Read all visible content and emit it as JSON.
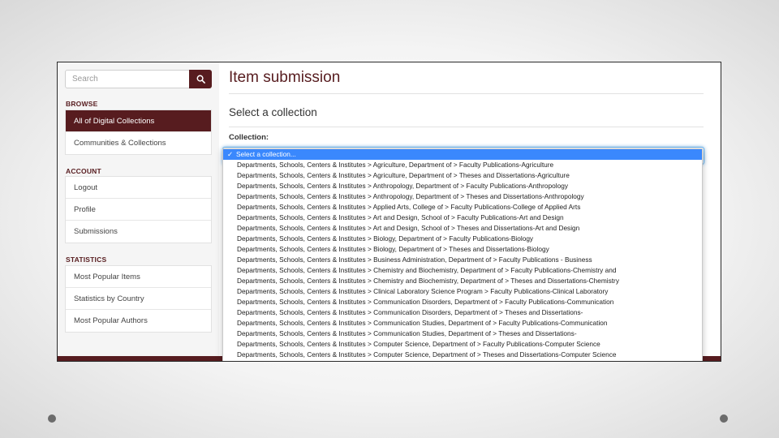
{
  "search": {
    "placeholder": "Search"
  },
  "sidebar": {
    "browse": {
      "heading": "BROWSE",
      "items": [
        {
          "label": "All of Digital Collections",
          "active": true
        },
        {
          "label": "Communities & Collections"
        }
      ]
    },
    "account": {
      "heading": "ACCOUNT",
      "items": [
        {
          "label": "Logout"
        },
        {
          "label": "Profile"
        },
        {
          "label": "Submissions"
        }
      ]
    },
    "statistics": {
      "heading": "STATISTICS",
      "items": [
        {
          "label": "Most Popular Items"
        },
        {
          "label": "Statistics by Country"
        },
        {
          "label": "Most Popular Authors"
        }
      ]
    }
  },
  "main": {
    "title": "Item submission",
    "section_title": "Select a collection",
    "collection_label": "Collection:",
    "selected_option": "Select a collection...",
    "options": [
      "Departments, Schools, Centers & Institutes > Agriculture, Department of > Faculty Publications-Agriculture",
      "Departments, Schools, Centers & Institutes > Agriculture, Department of > Theses and Dissertations-Agriculture",
      "Departments, Schools, Centers & Institutes > Anthropology, Department of > Faculty Publications-Anthropology",
      "Departments, Schools, Centers & Institutes > Anthropology, Department of > Theses and Dissertations-Anthropology",
      "Departments, Schools, Centers & Institutes > Applied Arts, College of > Faculty Publications-College of Applied Arts",
      "Departments, Schools, Centers & Institutes > Art and Design, School of > Faculty Publications-Art and Design",
      "Departments, Schools, Centers & Institutes > Art and Design, School of > Theses and Dissertations-Art and Design",
      "Departments, Schools, Centers & Institutes > Biology, Department of > Faculty Publications-Biology",
      "Departments, Schools, Centers & Institutes > Biology, Department of > Theses and Dissertations-Biology",
      "Departments, Schools, Centers & Institutes > Business Administration, Department of > Faculty Publications - Business",
      "Departments, Schools, Centers & Institutes > Chemistry and Biochemistry, Department of > Faculty Publications-Chemistry and",
      "Departments, Schools, Centers & Institutes > Chemistry and Biochemistry, Department of > Theses and Dissertations-Chemistry",
      "Departments, Schools, Centers & Institutes > Clinical Laboratory Science Program > Faculty Publications-Clinical Laboratory",
      "Departments, Schools, Centers & Institutes > Communication Disorders, Department of > Faculty Publications-Communication",
      "Departments, Schools, Centers & Institutes > Communication Disorders, Department of > Theses and Dissertations-",
      "Departments, Schools, Centers & Institutes > Communication Studies, Department of > Faculty Publications-Communication",
      "Departments, Schools, Centers & Institutes > Communication Studies, Department of > Theses and Dissertations-",
      "Departments, Schools, Centers & Institutes > Computer Science, Department of > Faculty Publications-Computer Science",
      "Departments, Schools, Centers & Institutes > Computer Science, Department of > Theses and Dissertations-Computer Science"
    ]
  },
  "colors": {
    "brand": "#571c1f",
    "highlight": "#3a88fd"
  },
  "icons": {
    "search": "search-icon",
    "check": "check-icon"
  }
}
